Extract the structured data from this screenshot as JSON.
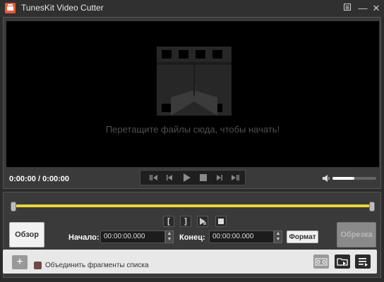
{
  "app": {
    "title": "TunesKit Video Cutter"
  },
  "window": {
    "menu_icon": "menu-icon",
    "minimize_glyph": "—",
    "close_glyph": "✕"
  },
  "player": {
    "drop_hint": "Перетащите файлы сюда, чтобы начать!",
    "time": "0:00:00 / 0:00:00",
    "volume_level": 0.5
  },
  "editor": {
    "mark_in": "[",
    "mark_out": "]",
    "browse_label": "Обзор",
    "start_label": "Начало:",
    "start_value": "00:00:00.000",
    "end_label": "Конец:",
    "end_value": "00:00:00.000",
    "format_label": "Формат",
    "cut_label": "Обрезка"
  },
  "bottom": {
    "add_glyph": "+",
    "merge_label": "Объединить фрагменты списка"
  },
  "colors": {
    "accent_timeline": "#e8d63a",
    "logo": "#e85a3c"
  }
}
